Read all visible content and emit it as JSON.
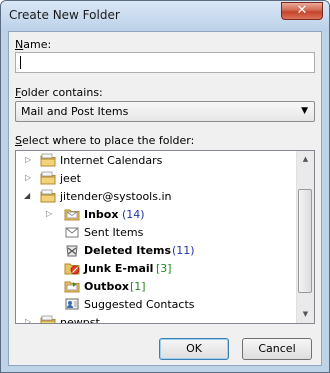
{
  "window": {
    "title": "Create New Folder",
    "close_glyph": "✕"
  },
  "name_field": {
    "label_key": "N",
    "label_rest": "ame:",
    "value": ""
  },
  "folder_contains": {
    "label_key": "F",
    "label_rest": "older contains:",
    "selected": "Mail and Post Items"
  },
  "location": {
    "label_key": "S",
    "label_rest": "elect where to place the folder:"
  },
  "tree": {
    "items": [
      {
        "label": "Internet Calendars",
        "count": "",
        "icon": "folder-icon"
      },
      {
        "label": "jeet",
        "count": "",
        "icon": "folder-icon"
      },
      {
        "label": "jitender@systools.in",
        "count": "",
        "icon": "folder-icon"
      },
      {
        "label": "Inbox",
        "count": "(14)",
        "icon": "inbox-icon"
      },
      {
        "label": "Sent Items",
        "count": "",
        "icon": "sent-items-icon"
      },
      {
        "label": "Deleted Items",
        "count": "(11)",
        "icon": "deleted-items-icon"
      },
      {
        "label": "Junk E-mail",
        "count": "[3]",
        "icon": "junk-email-icon"
      },
      {
        "label": "Outbox",
        "count": "[1]",
        "icon": "outbox-icon"
      },
      {
        "label": "Suggested Contacts",
        "count": "",
        "icon": "contacts-icon"
      },
      {
        "label": "newpst",
        "count": "",
        "icon": "folder-icon"
      }
    ]
  },
  "buttons": {
    "ok": "OK",
    "cancel": "Cancel"
  }
}
